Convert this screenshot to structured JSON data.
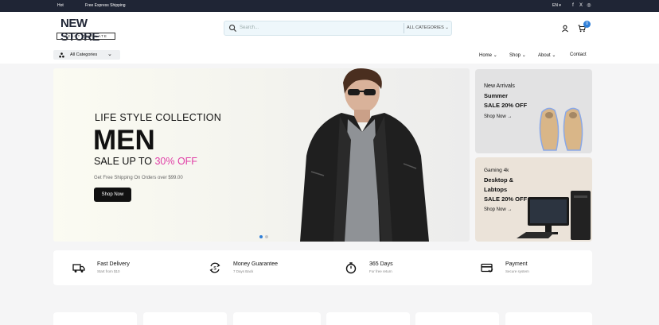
{
  "topbar": {
    "link_1": "Hot",
    "link_2": "Free Express Shipping",
    "language": "EN",
    "social": [
      {
        "icon": "facebook-icon",
        "glyph": "f"
      },
      {
        "icon": "x-twitter-icon",
        "glyph": "X"
      },
      {
        "icon": "instagram-icon",
        "glyph": "◎"
      }
    ]
  },
  "header": {
    "logo_line_1": "NEW STORE",
    "logo_line_2": "REACT TEMPLATE",
    "search_placeholder": "Search...",
    "search_category": "ALL CATEGORIES",
    "cart_count": "0"
  },
  "nav": {
    "all_categories": "All Categories",
    "items": [
      {
        "label": "Home",
        "has_dropdown": true
      },
      {
        "label": "Shop",
        "has_dropdown": true
      },
      {
        "label": "About",
        "has_dropdown": true
      },
      {
        "label": "Contact",
        "has_dropdown": false
      }
    ]
  },
  "hero": {
    "kicker": "LIFE STYLE COLLECTION",
    "headline": "MEN",
    "sale_prefix": "SALE UP TO",
    "sale_percent": "30% OFF",
    "note": "Get Free Shipping On Orders over $99.00",
    "button": "Shop Now",
    "slide_count": 2,
    "active_slide": 1
  },
  "side_banners": [
    {
      "line_1": "New Arrivals",
      "line_2": "Summer",
      "line_3": "SALE 20% OFF",
      "link": "Shop Now"
    },
    {
      "line_1": "Gaming 4k",
      "line_2": "Desktop &",
      "line_3": "Labtops",
      "line_4": "SALE 20% OFF",
      "link": "Shop Now"
    }
  ],
  "features": [
    {
      "icon": "delivery-truck-icon",
      "title": "Fast Delivery",
      "subtitle": "Start from $10"
    },
    {
      "icon": "money-guarantee-icon",
      "title": "Money Guarantee",
      "subtitle": "7 Days Back"
    },
    {
      "icon": "stopwatch-icon",
      "title": "365 Days",
      "subtitle": "For free return"
    },
    {
      "icon": "payment-card-icon",
      "title": "Payment",
      "subtitle": "Secure system"
    }
  ],
  "colors": {
    "topbar_bg": "#1f2535",
    "accent_pink": "#e03ea6",
    "badge_blue": "#2f7fd8",
    "button_black": "#111111"
  }
}
